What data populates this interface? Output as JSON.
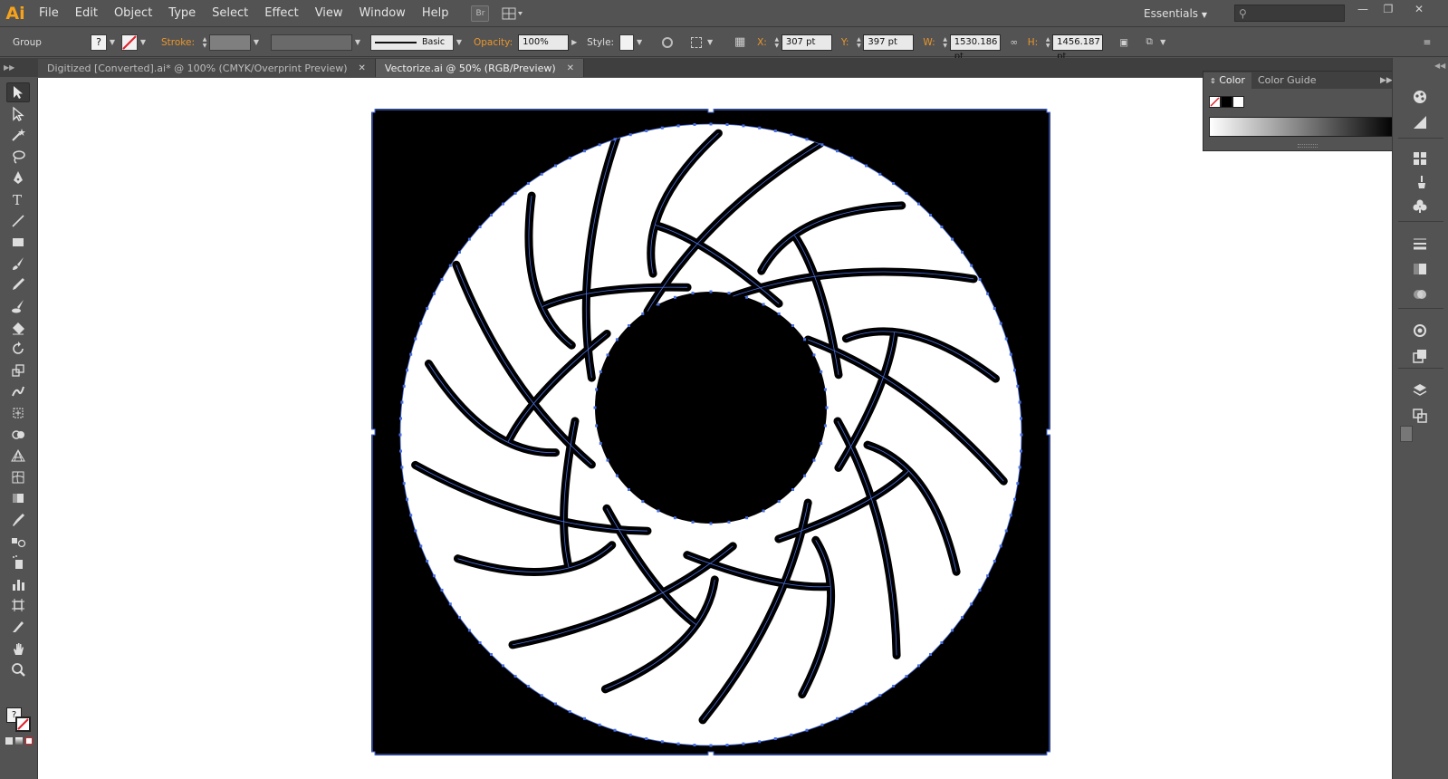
{
  "app": {
    "logo": "Ai",
    "bridge_btn": "Br",
    "menus": [
      "File",
      "Edit",
      "Object",
      "Type",
      "Select",
      "Effect",
      "View",
      "Window",
      "Help"
    ],
    "workspace": "Essentials",
    "window_controls": [
      "minimize",
      "restore",
      "close"
    ]
  },
  "controlbar": {
    "selection_type": "Group",
    "fill_unknown": "?",
    "stroke_label": "Stroke:",
    "brush_label": "Basic",
    "opacity_label": "Opacity:",
    "opacity_value": "100%",
    "style_label": "Style:",
    "x_label": "X:",
    "x_value": "307 pt",
    "y_label": "Y:",
    "y_value": "397 pt",
    "w_label": "W:",
    "w_value": "1530.186 pt",
    "h_label": "H:",
    "h_value": "1456.187 pt"
  },
  "tabs": [
    {
      "label": "Digitized [Converted].ai* @ 100% (CMYK/Overprint Preview)",
      "active": false
    },
    {
      "label": "Vectorize.ai @ 50% (RGB/Preview)",
      "active": true
    }
  ],
  "tools": [
    "selection-tool",
    "direct-selection-tool",
    "magic-wand-tool",
    "lasso-tool",
    "pen-tool",
    "type-tool",
    "line-segment-tool",
    "rectangle-tool",
    "paintbrush-tool",
    "pencil-tool",
    "blob-brush-tool",
    "eraser-tool",
    "rotate-tool",
    "scale-tool",
    "warp-tool",
    "free-transform-tool",
    "shape-builder-tool",
    "perspective-grid-tool",
    "mesh-tool",
    "gradient-tool",
    "eyedropper-tool",
    "blend-tool",
    "symbol-sprayer-tool",
    "column-graph-tool",
    "artboard-tool",
    "slice-tool",
    "hand-tool",
    "zoom-tool"
  ],
  "color_panel": {
    "tabs": [
      "Color",
      "Color Guide"
    ],
    "active_tab": "Color"
  },
  "colors": {
    "ui_bg": "#535353",
    "accent_orange": "#e8962c",
    "selection_blue": "#4a6fe0",
    "artboard_black": "#000000",
    "artwork_white": "#ffffff"
  }
}
